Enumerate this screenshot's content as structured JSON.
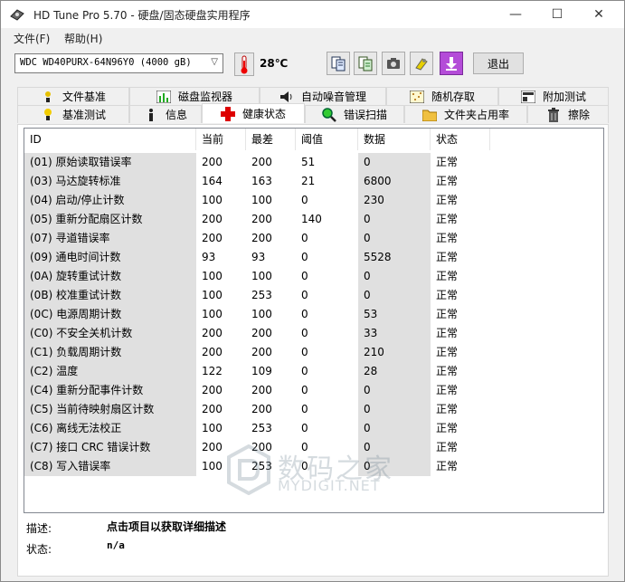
{
  "window": {
    "title": "HD Tune Pro 5.70 - 硬盘/固态硬盘实用程序",
    "minimize_glyph": "—",
    "maximize_glyph": "☐",
    "close_glyph": "✕"
  },
  "menu": [
    "文件(F)",
    "帮助(H)"
  ],
  "toolbar": {
    "drive": "WDC WD40PURX-64N96Y0 (4000 gB)",
    "temperature": "28℃",
    "tool_icons": [
      "copy-text-icon",
      "copy-info-icon",
      "camera-icon",
      "options-icon",
      "save-icon"
    ],
    "exit_label": "退出"
  },
  "tabs_row1": [
    {
      "label": "文件基准",
      "icon": "benchmark-file-icon"
    },
    {
      "label": "磁盘监视器",
      "icon": "disk-monitor-icon"
    },
    {
      "label": "自动噪音管理",
      "icon": "speaker-icon"
    },
    {
      "label": "随机存取",
      "icon": "random-access-icon"
    },
    {
      "label": "附加测试",
      "icon": "extra-tests-icon"
    }
  ],
  "tabs_row2": [
    {
      "label": "基准测试",
      "icon": "benchmark-icon"
    },
    {
      "label": "信息",
      "icon": "info-icon"
    },
    {
      "label": "健康状态",
      "icon": "health-cross-icon",
      "active": true
    },
    {
      "label": "错误扫描",
      "icon": "magnifier-icon"
    },
    {
      "label": "文件夹占用率",
      "icon": "folder-icon"
    },
    {
      "label": "擦除",
      "icon": "trash-icon"
    }
  ],
  "smart_table": {
    "columns": [
      "ID",
      "当前",
      "最差",
      "阈值",
      "数据",
      "状态"
    ],
    "rows": [
      [
        "(01) 原始读取错误率",
        "200",
        "200",
        "51",
        "0",
        "正常"
      ],
      [
        "(03) 马达旋转标准",
        "164",
        "163",
        "21",
        "6800",
        "正常"
      ],
      [
        "(04) 启动/停止计数",
        "100",
        "100",
        "0",
        "230",
        "正常"
      ],
      [
        "(05) 重新分配扇区计数",
        "200",
        "200",
        "140",
        "0",
        "正常"
      ],
      [
        "(07) 寻道错误率",
        "200",
        "200",
        "0",
        "0",
        "正常"
      ],
      [
        "(09) 通电时间计数",
        "93",
        "93",
        "0",
        "5528",
        "正常"
      ],
      [
        "(0A) 旋转重试计数",
        "100",
        "100",
        "0",
        "0",
        "正常"
      ],
      [
        "(0B) 校准重试计数",
        "100",
        "253",
        "0",
        "0",
        "正常"
      ],
      [
        "(0C) 电源周期计数",
        "100",
        "100",
        "0",
        "53",
        "正常"
      ],
      [
        "(C0) 不安全关机计数",
        "200",
        "200",
        "0",
        "33",
        "正常"
      ],
      [
        "(C1) 负载周期计数",
        "200",
        "200",
        "0",
        "210",
        "正常"
      ],
      [
        "(C2) 温度",
        "122",
        "109",
        "0",
        "28",
        "正常"
      ],
      [
        "(C4) 重新分配事件计数",
        "200",
        "200",
        "0",
        "0",
        "正常"
      ],
      [
        "(C5) 当前待映射扇区计数",
        "200",
        "200",
        "0",
        "0",
        "正常"
      ],
      [
        "(C6) 离线无法校正",
        "100",
        "253",
        "0",
        "0",
        "正常"
      ],
      [
        "(C7) 接口 CRC 错误计数",
        "200",
        "200",
        "0",
        "0",
        "正常"
      ],
      [
        "(C8) 写入错误率",
        "100",
        "253",
        "0",
        "0",
        "正常"
      ]
    ]
  },
  "description": {
    "label": "描述:",
    "value": "点击项目以获取详细描述"
  },
  "status": {
    "label": "状态:",
    "value": "n/a"
  },
  "watermark": {
    "text": "数码之家",
    "sub": "MYDIGIT.NET"
  }
}
